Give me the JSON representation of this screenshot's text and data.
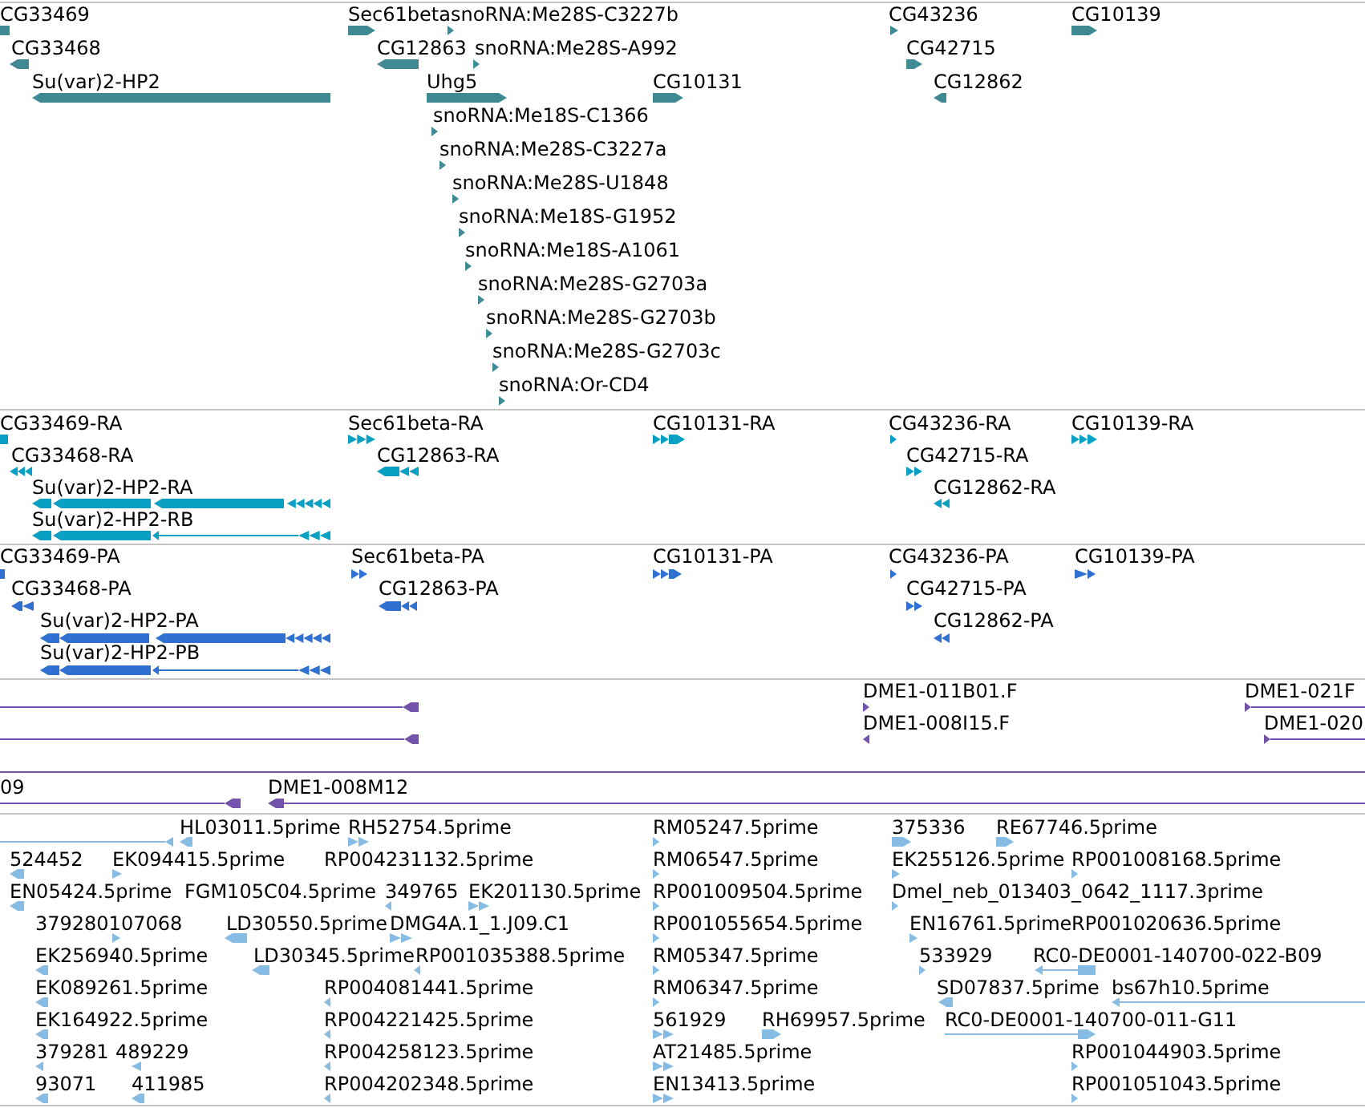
{
  "tracks": [
    {
      "kind": "gene",
      "features": [
        {
          "label": "CG33469"
        },
        {
          "label": "Sec61beta",
          "reverse": false
        },
        {
          "label": "snoRNA:Me28S-C3227b",
          "reverse": false
        },
        {
          "label": "CG43236",
          "reverse": false
        },
        {
          "label": "CG10139",
          "reverse": false
        },
        {
          "label": "CG33468",
          "reverse": true
        },
        {
          "label": "CG12863",
          "reverse": true
        },
        {
          "label": "snoRNA:Me28S-A992",
          "reverse": false
        },
        {
          "label": "CG42715",
          "reverse": false
        },
        {
          "label": "Su(var)2-HP2",
          "reverse": true
        },
        {
          "label": "Uhg5",
          "reverse": false
        },
        {
          "label": "CG10131",
          "reverse": false
        },
        {
          "label": "CG12862",
          "reverse": true
        },
        {
          "label": "snoRNA:Me18S-C1366",
          "reverse": false
        },
        {
          "label": "snoRNA:Me28S-C3227a",
          "reverse": false
        },
        {
          "label": "snoRNA:Me28S-U1848",
          "reverse": false
        },
        {
          "label": "snoRNA:Me18S-G1952",
          "reverse": false
        },
        {
          "label": "snoRNA:Me18S-A1061",
          "reverse": false
        },
        {
          "label": "snoRNA:Me28S-G2703a",
          "reverse": false
        },
        {
          "label": "snoRNA:Me28S-G2703b",
          "reverse": false
        },
        {
          "label": "snoRNA:Me28S-G2703c",
          "reverse": false
        },
        {
          "label": "snoRNA:Or-CD4",
          "reverse": false
        }
      ]
    },
    {
      "kind": "transcript",
      "features": [
        {
          "label": "CG33469-RA"
        },
        {
          "label": "Sec61beta-RA",
          "reverse": false
        },
        {
          "label": "CG10131-RA",
          "reverse": false
        },
        {
          "label": "CG43236-RA",
          "reverse": false
        },
        {
          "label": "CG10139-RA",
          "reverse": false
        },
        {
          "label": "CG33468-RA",
          "reverse": true
        },
        {
          "label": "CG12863-RA",
          "reverse": true
        },
        {
          "label": "CG42715-RA",
          "reverse": false
        },
        {
          "label": "Su(var)2-HP2-RA",
          "reverse": true
        },
        {
          "label": "CG12862-RA",
          "reverse": true
        },
        {
          "label": "Su(var)2-HP2-RB",
          "reverse": true
        }
      ]
    },
    {
      "kind": "protein",
      "features": [
        {
          "label": "CG33469-PA"
        },
        {
          "label": "Sec61beta-PA",
          "reverse": false
        },
        {
          "label": "CG10131-PA",
          "reverse": false
        },
        {
          "label": "CG43236-PA",
          "reverse": false
        },
        {
          "label": "CG10139-PA",
          "reverse": false
        },
        {
          "label": "CG33468-PA",
          "reverse": true
        },
        {
          "label": "CG12863-PA",
          "reverse": true
        },
        {
          "label": "CG42715-PA",
          "reverse": false
        },
        {
          "label": "Su(var)2-HP2-PA",
          "reverse": true
        },
        {
          "label": "CG12862-PA",
          "reverse": true
        },
        {
          "label": "Su(var)2-HP2-PB",
          "reverse": true
        }
      ]
    },
    {
      "kind": "clone",
      "features": [
        {
          "kind": "pair",
          "reverse": true
        },
        {
          "kind": "read",
          "label": "DME1-011B01.F",
          "reverse": false
        },
        {
          "kind": "pair",
          "label": "DME1-021F",
          "reverse": false
        },
        {
          "kind": "pair",
          "reverse": true
        },
        {
          "kind": "read",
          "label": "DME1-008I15.F",
          "reverse": true
        },
        {
          "kind": "pair",
          "label": "DME1-020",
          "reverse": false
        },
        {
          "kind": "span"
        },
        {
          "kind": "pair",
          "label": "09",
          "reverse": true
        },
        {
          "kind": "pair",
          "label": "DME1-008M12",
          "reverse": true
        }
      ]
    },
    {
      "kind": "est",
      "features": [
        {
          "reverse": true
        },
        {
          "label": "HL03011.5prime",
          "reverse": true
        },
        {
          "label": "RH52754.5prime",
          "reverse": false
        },
        {
          "label": "RM05247.5prime",
          "reverse": false
        },
        {
          "label": "375336",
          "reverse": false
        },
        {
          "label": "RE67746.5prime",
          "reverse": false
        },
        {
          "label": "524452",
          "reverse": true
        },
        {
          "label": "EK094415.5prime",
          "reverse": false
        },
        {
          "label": "RP004231132.5prime"
        },
        {
          "label": "RM06547.5prime",
          "reverse": false
        },
        {
          "label": "EK255126.5prime",
          "reverse": false
        },
        {
          "label": "RP001008168.5prime",
          "reverse": false
        },
        {
          "label": "EN05424.5prime",
          "reverse": true
        },
        {
          "label": "FGM105C04.5prime"
        },
        {
          "label": "349765",
          "reverse": true
        },
        {
          "label": "EK201130.5prime",
          "reverse": false
        },
        {
          "label": "RP001009504.5prime",
          "reverse": false
        },
        {
          "label": "Dmel_neb_013403_0642_1117.3prime",
          "reverse": false
        },
        {
          "label": "379280107068",
          "reverse": false
        },
        {
          "label": "LD30550.5prime",
          "reverse": true
        },
        {
          "label": "DMG4A.1_1.J09.C1",
          "reverse": false
        },
        {
          "label": "RP001055654.5prime",
          "reverse": false
        },
        {
          "label": "EN16761.5prime",
          "reverse": false
        },
        {
          "label": "RP001020636.5prime"
        },
        {
          "label": "EK256940.5prime",
          "reverse": true
        },
        {
          "label": "LD30345.5prime",
          "reverse": true
        },
        {
          "label": "RP001035388.5prime",
          "reverse": true
        },
        {
          "label": "RM05347.5prime",
          "reverse": false
        },
        {
          "label": "533929",
          "reverse": false
        },
        {
          "label": "RC0-DE0001-140700-022-B09",
          "reverse": true
        },
        {
          "label": "EK089261.5prime",
          "reverse": true
        },
        {
          "label": "RP004081441.5prime",
          "reverse": true
        },
        {
          "label": "RM06347.5prime",
          "reverse": false
        },
        {
          "label": "SD07837.5prime",
          "reverse": true
        },
        {
          "label": "bs67h10.5prime",
          "reverse": true
        },
        {
          "label": "EK164922.5prime",
          "reverse": true
        },
        {
          "label": "RP004221425.5prime",
          "reverse": true
        },
        {
          "label": "561929",
          "reverse": false
        },
        {
          "label": "RH69957.5prime",
          "reverse": false
        },
        {
          "label": "RC0-DE0001-140700-011-G11",
          "reverse": false
        },
        {
          "label": "379281",
          "reverse": true
        },
        {
          "label": "489229",
          "reverse": true
        },
        {
          "label": "RP004258123.5prime",
          "reverse": true
        },
        {
          "label": "AT21485.5prime",
          "reverse": false
        },
        {
          "label": "RP001044903.5prime",
          "reverse": false
        },
        {
          "label": "93071",
          "reverse": true
        },
        {
          "label": "411985",
          "reverse": true
        },
        {
          "label": "RP004202348.5prime",
          "reverse": true
        },
        {
          "label": "EN13413.5prime",
          "reverse": false
        },
        {
          "label": "RP001051043.5prime",
          "reverse": false
        }
      ]
    }
  ]
}
